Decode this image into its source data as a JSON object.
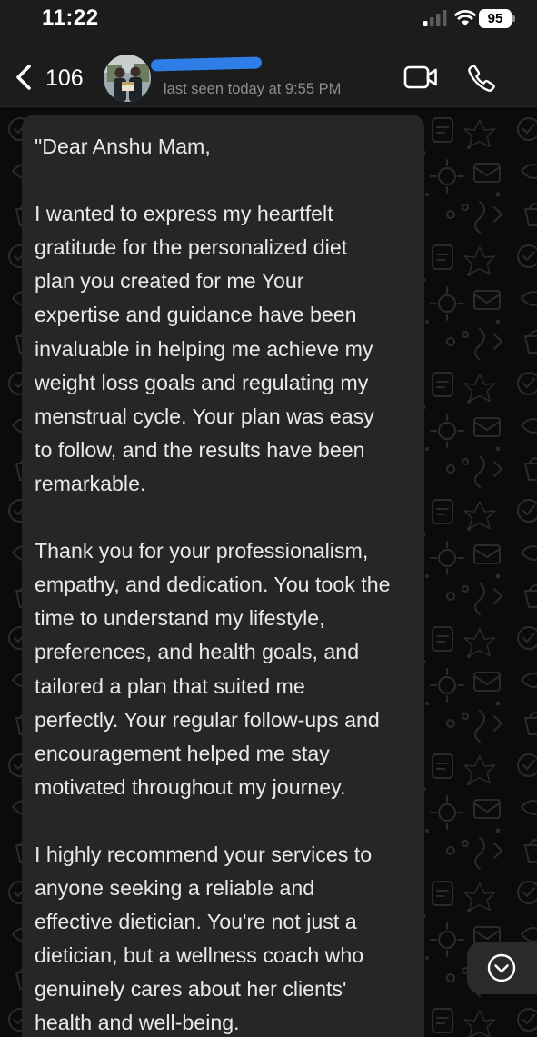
{
  "status_bar": {
    "time": "11:22",
    "battery": "95",
    "icons": [
      "cellular-signal-icon",
      "wifi-icon",
      "battery-icon"
    ]
  },
  "header": {
    "back_count": "106",
    "last_seen": "last seen today at 9:55 PM",
    "name_redacted": true,
    "icons": [
      "chevron-left-icon",
      "video-call-icon",
      "phone-icon"
    ]
  },
  "message": {
    "text": "\"Dear Anshu Mam,\n\nI wanted to express my heartfelt\ngratitude for the personalized diet\nplan you created for me Your\nexpertise and guidance have been\ninvaluable in helping me achieve my\nweight loss goals and regulating my\nmenstrual cycle. Your plan was easy\nto follow, and the results have been\nremarkable.\n\nThank you for your professionalism,\nempathy, and dedication. You took the\ntime to understand my lifestyle,\npreferences, and health goals, and\ntailored a plan that suited me\nperfectly. Your regular follow-ups and\nencouragement helped me stay\nmotivated throughout my journey.\n\nI highly recommend your services to\nanyone seeking a reliable and\neffective dietician. You're not just a\ndietician, but a wellness coach who\ngenuinely cares about her clients'\nhealth and well-being."
  },
  "colors": {
    "background": "#0b0b0b",
    "header": "#1c1c1d",
    "bubble": "#262628",
    "text": "#e9e9ea",
    "secondary_text": "#8d8d92",
    "redaction": "#2f7ee8"
  }
}
